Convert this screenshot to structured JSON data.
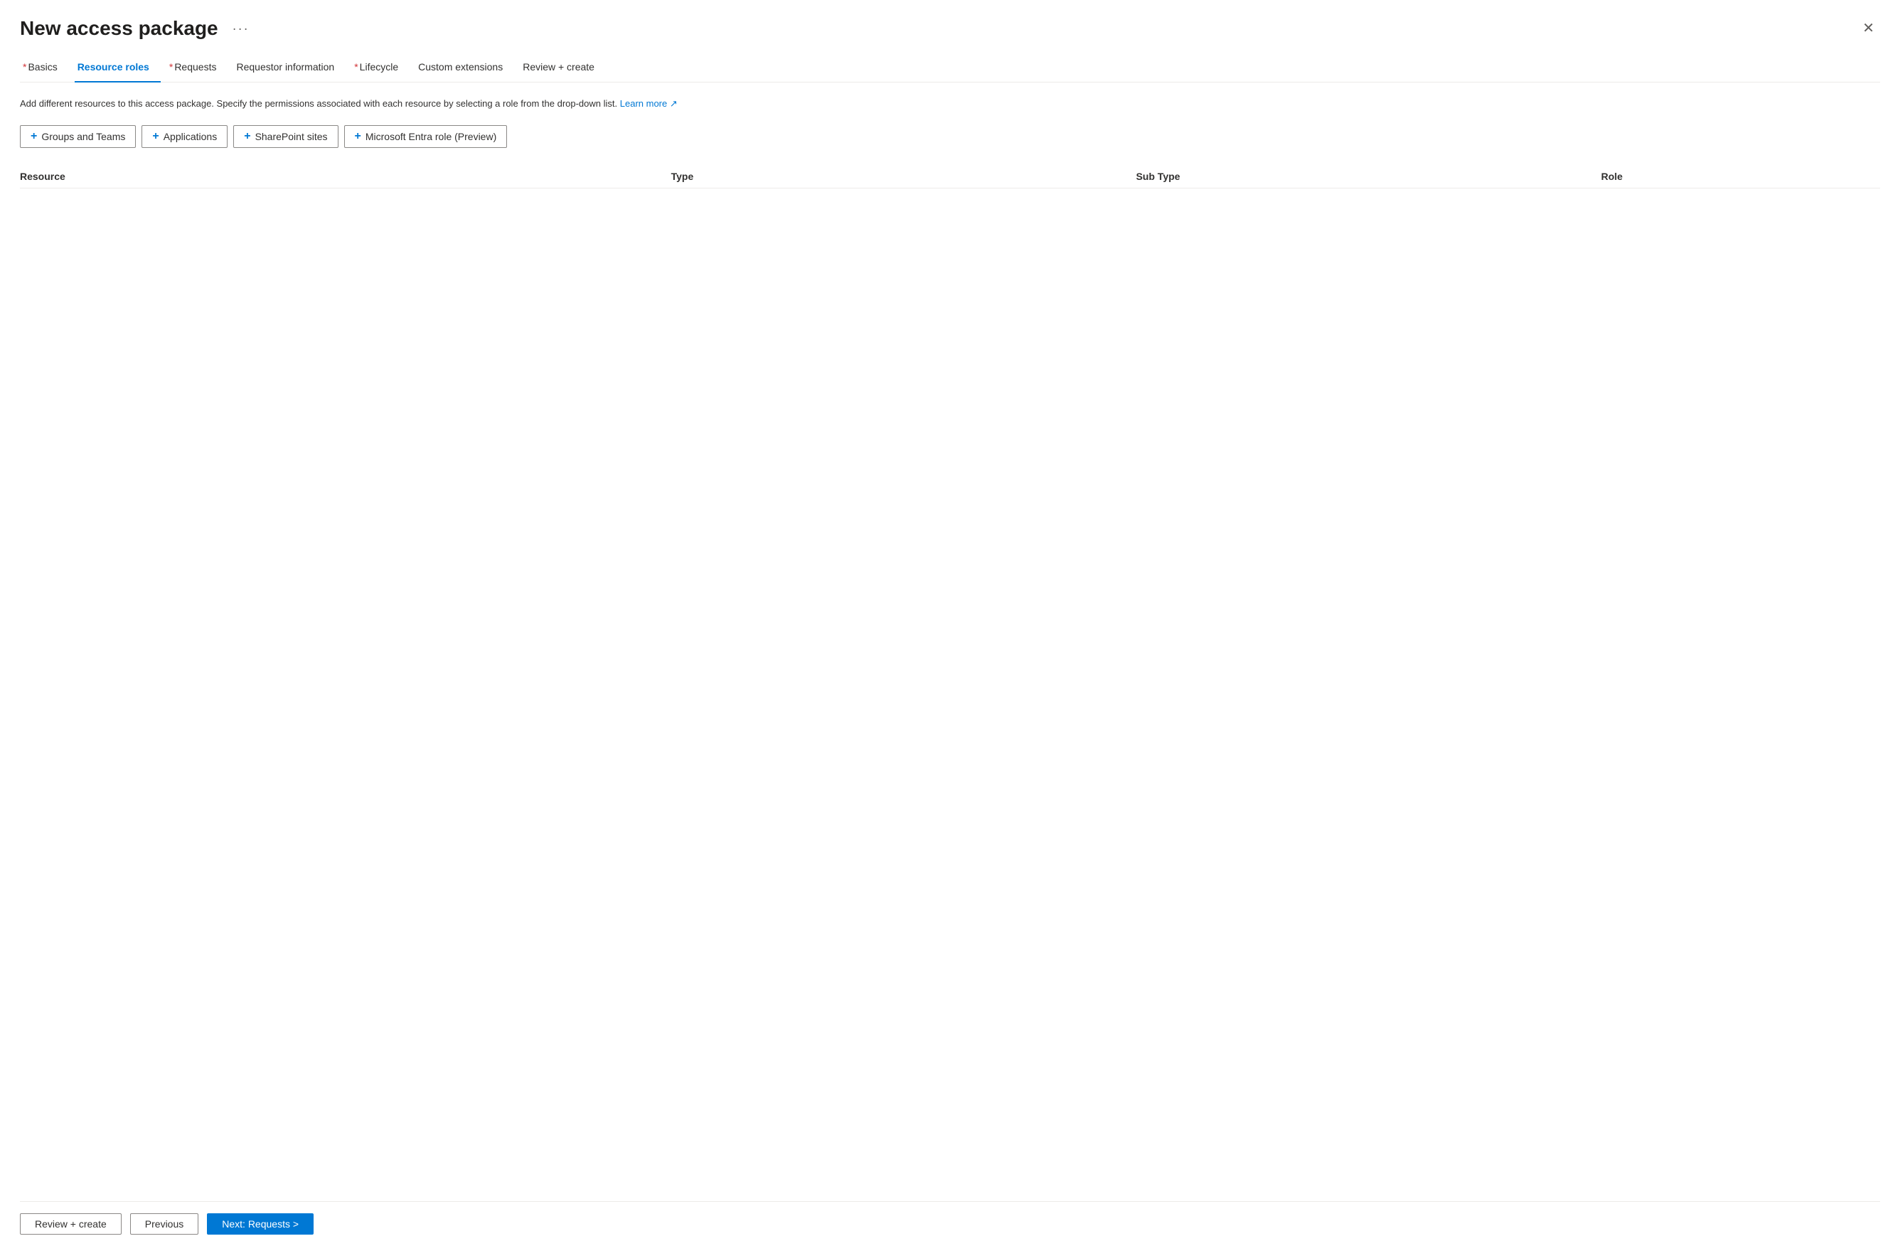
{
  "header": {
    "title": "New access package",
    "ellipsis_label": "···",
    "close_label": "✕"
  },
  "tabs": [
    {
      "id": "basics",
      "label": "Basics",
      "required": true,
      "active": false
    },
    {
      "id": "resource-roles",
      "label": "Resource roles",
      "required": false,
      "active": true
    },
    {
      "id": "requests",
      "label": "Requests",
      "required": true,
      "active": false
    },
    {
      "id": "requestor-info",
      "label": "Requestor information",
      "required": false,
      "active": false
    },
    {
      "id": "lifecycle",
      "label": "Lifecycle",
      "required": true,
      "active": false
    },
    {
      "id": "custom-extensions",
      "label": "Custom extensions",
      "required": false,
      "active": false
    },
    {
      "id": "review-create",
      "label": "Review + create",
      "required": false,
      "active": false
    }
  ],
  "info": {
    "text": "Add different resources to this access package. Specify the permissions associated with each resource by selecting a role from the drop-down list.",
    "learn_more_label": "Learn more",
    "external_link_icon": "↗"
  },
  "resource_buttons": [
    {
      "id": "groups-teams",
      "label": "Groups and Teams",
      "plus": "+"
    },
    {
      "id": "applications",
      "label": "Applications",
      "plus": "+"
    },
    {
      "id": "sharepoint-sites",
      "label": "SharePoint sites",
      "plus": "+"
    },
    {
      "id": "entra-role",
      "label": "Microsoft Entra role (Preview)",
      "plus": "+"
    }
  ],
  "table": {
    "columns": [
      {
        "id": "resource",
        "label": "Resource"
      },
      {
        "id": "type",
        "label": "Type"
      },
      {
        "id": "sub-type",
        "label": "Sub Type"
      },
      {
        "id": "role",
        "label": "Role"
      }
    ],
    "rows": []
  },
  "bottom_bar": {
    "review_create_label": "Review + create",
    "previous_label": "Previous",
    "next_label": "Next: Requests >"
  }
}
